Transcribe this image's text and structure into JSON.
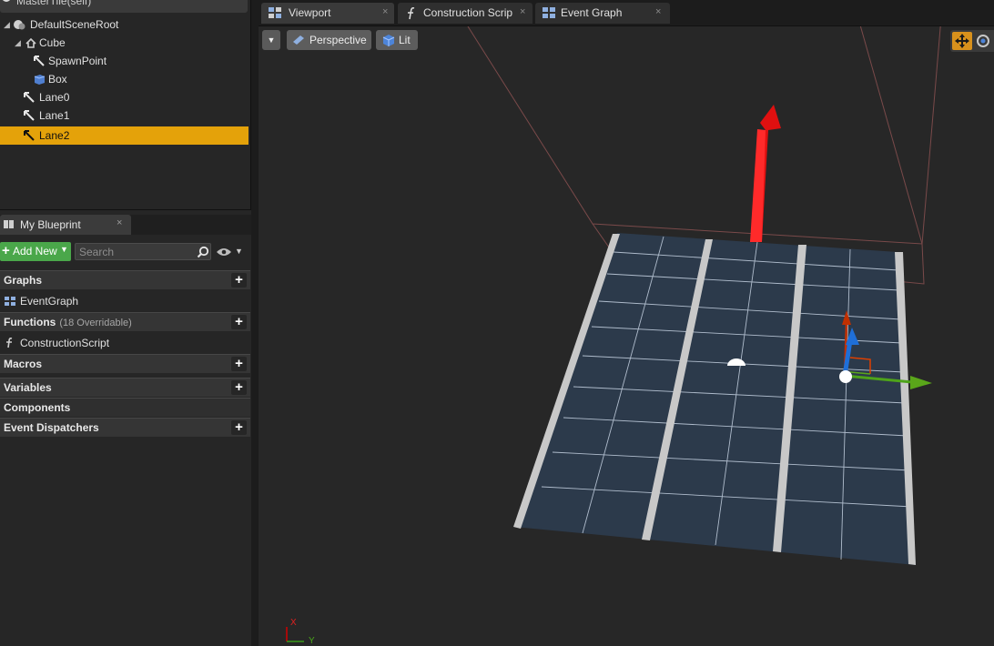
{
  "components": {
    "header_title": "MasterTile(self)",
    "items": [
      {
        "label": "DefaultSceneRoot"
      },
      {
        "label": "Cube"
      },
      {
        "label": "SpawnPoint"
      },
      {
        "label": "Box"
      },
      {
        "label": "Lane0"
      },
      {
        "label": "Lane1"
      },
      {
        "label": "Lane2"
      }
    ],
    "selected": "Lane2"
  },
  "my_blueprint": {
    "tab_label": "My Blueprint",
    "close": "×",
    "add_new_label": "Add New",
    "search_placeholder": "Search",
    "sections": {
      "graphs": {
        "label": "Graphs",
        "items": [
          "EventGraph"
        ]
      },
      "functions": {
        "label": "Functions",
        "sub": "(18 Overridable)",
        "items": [
          "ConstructionScript"
        ]
      },
      "macros": {
        "label": "Macros"
      },
      "variables": {
        "label": "Variables"
      },
      "components": {
        "label": "Components"
      },
      "event_dispatchers": {
        "label": "Event Dispatchers"
      }
    },
    "add_symbol": "+"
  },
  "tabs": [
    {
      "label": "Viewport",
      "icon": "viewport-icon",
      "active": true
    },
    {
      "label": "Construction Scrip",
      "icon": "function-icon",
      "active": false
    },
    {
      "label": "Event Graph",
      "icon": "graph-icon",
      "active": false
    }
  ],
  "viewport": {
    "perspective_label": "Perspective",
    "lit_label": "Lit",
    "axis_x": "X",
    "axis_y": "Y"
  },
  "colors": {
    "selection": "#e4a20a",
    "add_new": "#4aa74a",
    "gizmo_x": "#d40000",
    "gizmo_y": "#5aa61a",
    "gizmo_z": "#1f6fd8"
  }
}
